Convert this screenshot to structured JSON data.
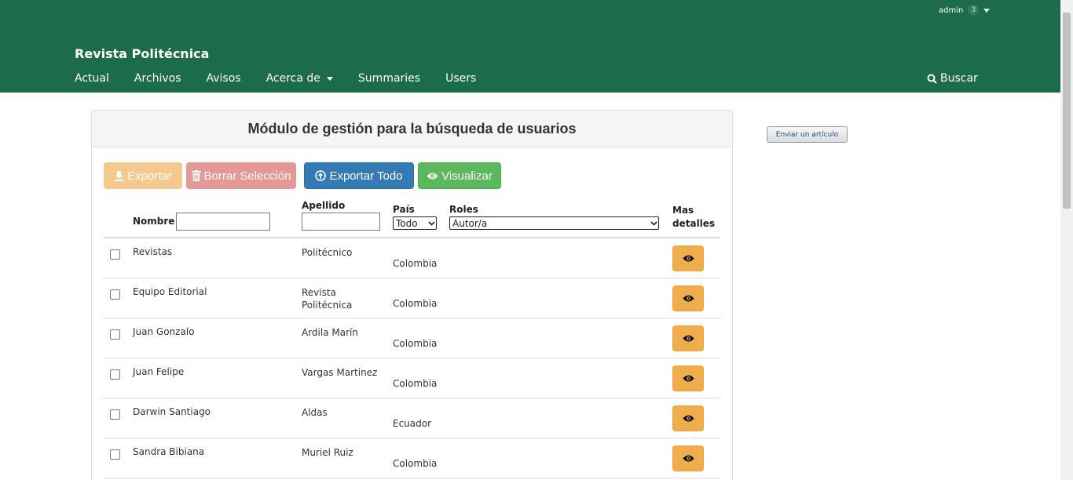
{
  "header": {
    "user": "admin",
    "user_count": "3",
    "site_title": "Revista Politécnica",
    "nav": [
      "Actual",
      "Archivos",
      "Avisos",
      "Acerca de",
      "Summaries",
      "Users"
    ],
    "search_label": "Buscar"
  },
  "panel": {
    "title": "Módulo de gestión para la búsqueda de usuarios",
    "buttons": {
      "export": "Exportar",
      "delete": "Borrar Selección",
      "export_all": "Exportar Todo",
      "view": "Visualizar"
    },
    "filters": {
      "name_label": "Nombre",
      "last_label": "Apellido",
      "country_label": "País",
      "country_value": "Todo",
      "roles_label": "Roles",
      "roles_value": "Autor/a",
      "details_label_1": "Mas",
      "details_label_2": "detalles"
    },
    "rows": [
      {
        "name": "Revistas",
        "last": "Politécnico",
        "country": "Colombia"
      },
      {
        "name": "Equipo Editorial",
        "last": "Revista Politécnica",
        "country": "Colombia"
      },
      {
        "name": "Juan Gonzalo",
        "last": "Ardila Marín",
        "country": "Colombia"
      },
      {
        "name": "Juan Felipe",
        "last": "Vargas Martinez",
        "country": "Colombia"
      },
      {
        "name": "Darwin Santiago",
        "last": "Aldas",
        "country": "Ecuador"
      },
      {
        "name": "Sandra Bibiana",
        "last": "Muriel Ruiz",
        "country": "Colombia"
      }
    ]
  },
  "sidebar": {
    "submit_button": "Enviar un artículo"
  },
  "colors": {
    "header_bg": "#1c6b4a",
    "export_btn": "#f5c88e",
    "delete_btn": "#e59895",
    "export_all_btn": "#337ab7",
    "view_btn": "#5cb85c",
    "detail_btn": "#f0ad4e"
  }
}
